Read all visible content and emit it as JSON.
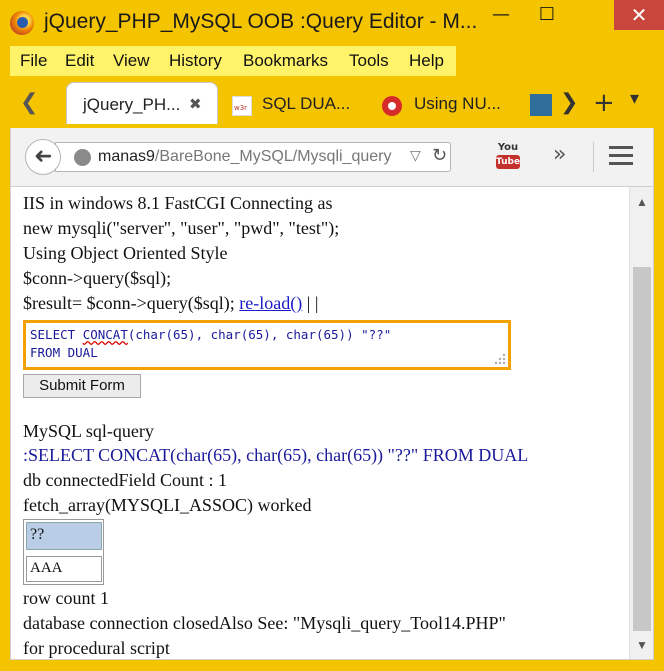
{
  "window": {
    "title": "jQuery_PHP_MySQL OOB :Query Editor - M...",
    "minimize": "—",
    "maximize": "☐",
    "close": "✕"
  },
  "menu": [
    "File",
    "Edit",
    "View",
    "History",
    "Bookmarks",
    "Tools",
    "Help"
  ],
  "tabs": [
    {
      "label": "jQuery_PH...",
      "active": true,
      "close": "✖"
    },
    {
      "label": "SQL DUA...",
      "active": false
    },
    {
      "label": "Using NU...",
      "active": false
    }
  ],
  "tabstrip": {
    "scroll_left": "❮",
    "scroll_right": "❯",
    "new_tab": "+",
    "list_tabs": "▾"
  },
  "navbar": {
    "back": "➜",
    "url_host": "manas9",
    "url_path": "/BareBone_MySQL/Mysqli_query",
    "url_dropdown": "▽",
    "reload": "↻",
    "yt_top": "You",
    "yt_bottom": "Tube",
    "overflow": "»"
  },
  "content": {
    "lines_top": [
      "IIS in windows 8.1 FastCGI Connecting as",
      "new mysqli(\"server\", \"user\", \"pwd\", \"test\");",
      "Using Object Oriented Style",
      "$conn->query($sql);"
    ],
    "result_line_prefix": "$result= $conn->query($sql); ",
    "reload_link": "re-load()",
    "result_line_suffix": " | |",
    "sql_line1_a": "SELECT ",
    "sql_line1_b": "CONCAT",
    "sql_line1_c": "(char(65), char(65), char(65)) \"??\"",
    "sql_line2": "FROM DUAL",
    "submit": "Submit Form",
    "section_title": "MySQL sql-query",
    "query_echo": ":SELECT CONCAT(char(65), char(65), char(65)) \"??\" FROM DUAL",
    "db_status": "db connectedField Count : 1",
    "fetch_status": "fetch_array(MYSQLI_ASSOC) worked",
    "table_header": "??",
    "table_value": "AAA",
    "row_count": "row count 1",
    "closed_line": "database connection closedAlso See: \"Mysqli_query_Tool14.PHP\"",
    "procedural_line": "for procedural script"
  },
  "colors": {
    "titlebar": "#f5c400",
    "menu_highlight": "#fff36a",
    "sql_border": "#f2a100",
    "link": "#1a1ac8",
    "table_header": "#b9cde6"
  }
}
